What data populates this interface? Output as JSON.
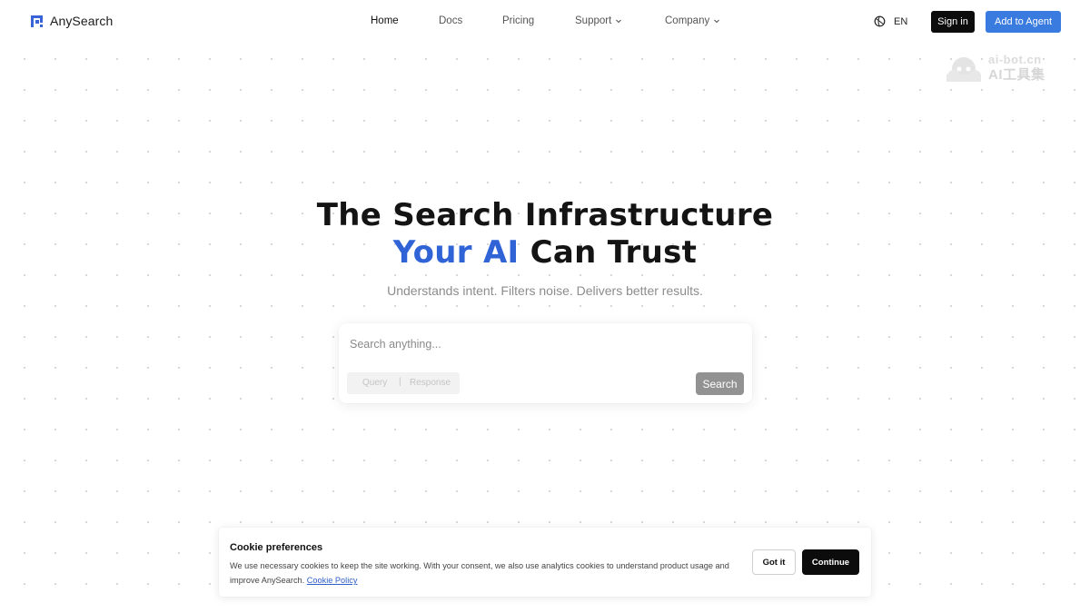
{
  "header": {
    "brand": "AnySearch",
    "nav": {
      "home": "Home",
      "docs": "Docs",
      "pricing": "Pricing",
      "support": "Support",
      "company": "Company"
    },
    "language": "EN",
    "sign_in": "Sign in",
    "add_to_agent": "Add to Agent"
  },
  "watermark": {
    "line1": "ai-bot.cn",
    "line2": "AI工具集"
  },
  "hero": {
    "line1": "The Search Infrastructure",
    "accent": "Your AI",
    "line2_rest": "Can Trust",
    "subtitle": "Understands intent. Filters noise. Delivers better results."
  },
  "search": {
    "placeholder": "Search anything...",
    "mode_query": "Query",
    "mode_separator": "|",
    "mode_response": "Response",
    "button": "Search"
  },
  "cookie": {
    "title": "Cookie preferences",
    "text": "We use necessary cookies to keep the site working. With your consent, we also use analytics cookies to understand product usage and improve AnySearch.",
    "link": "Cookie Policy",
    "got_it": "Got it",
    "continue": "Continue"
  },
  "colors": {
    "accent": "#2f63d6",
    "primary_button": "#3a7be0",
    "dark_button": "#0c0c0c"
  },
  "icons": {
    "logo": "anysearch-logo-icon",
    "language": "globe-icon",
    "dropdown": "chevron-down-icon"
  }
}
